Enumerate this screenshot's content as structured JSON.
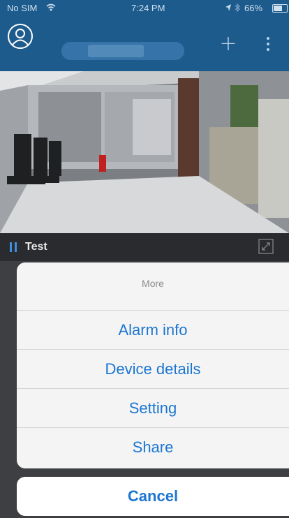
{
  "status_bar": {
    "carrier": "No SIM",
    "time": "7:24 PM",
    "battery": "66%"
  },
  "nav": {
    "icons": [
      "person-circle-icon",
      "plus-icon",
      "more-vertical-icon"
    ]
  },
  "camera": {
    "name": "Test",
    "icons": [
      "pause-icon",
      "fullscreen-icon"
    ]
  },
  "action_sheet": {
    "title": "More",
    "items": [
      "Alarm info",
      "Device details",
      "Setting",
      "Share"
    ],
    "cancel": "Cancel"
  },
  "colors": {
    "header_blue": "#1e5b8d",
    "action_blue": "#1c76d2",
    "sheet_bg": "#f4f4f4"
  }
}
